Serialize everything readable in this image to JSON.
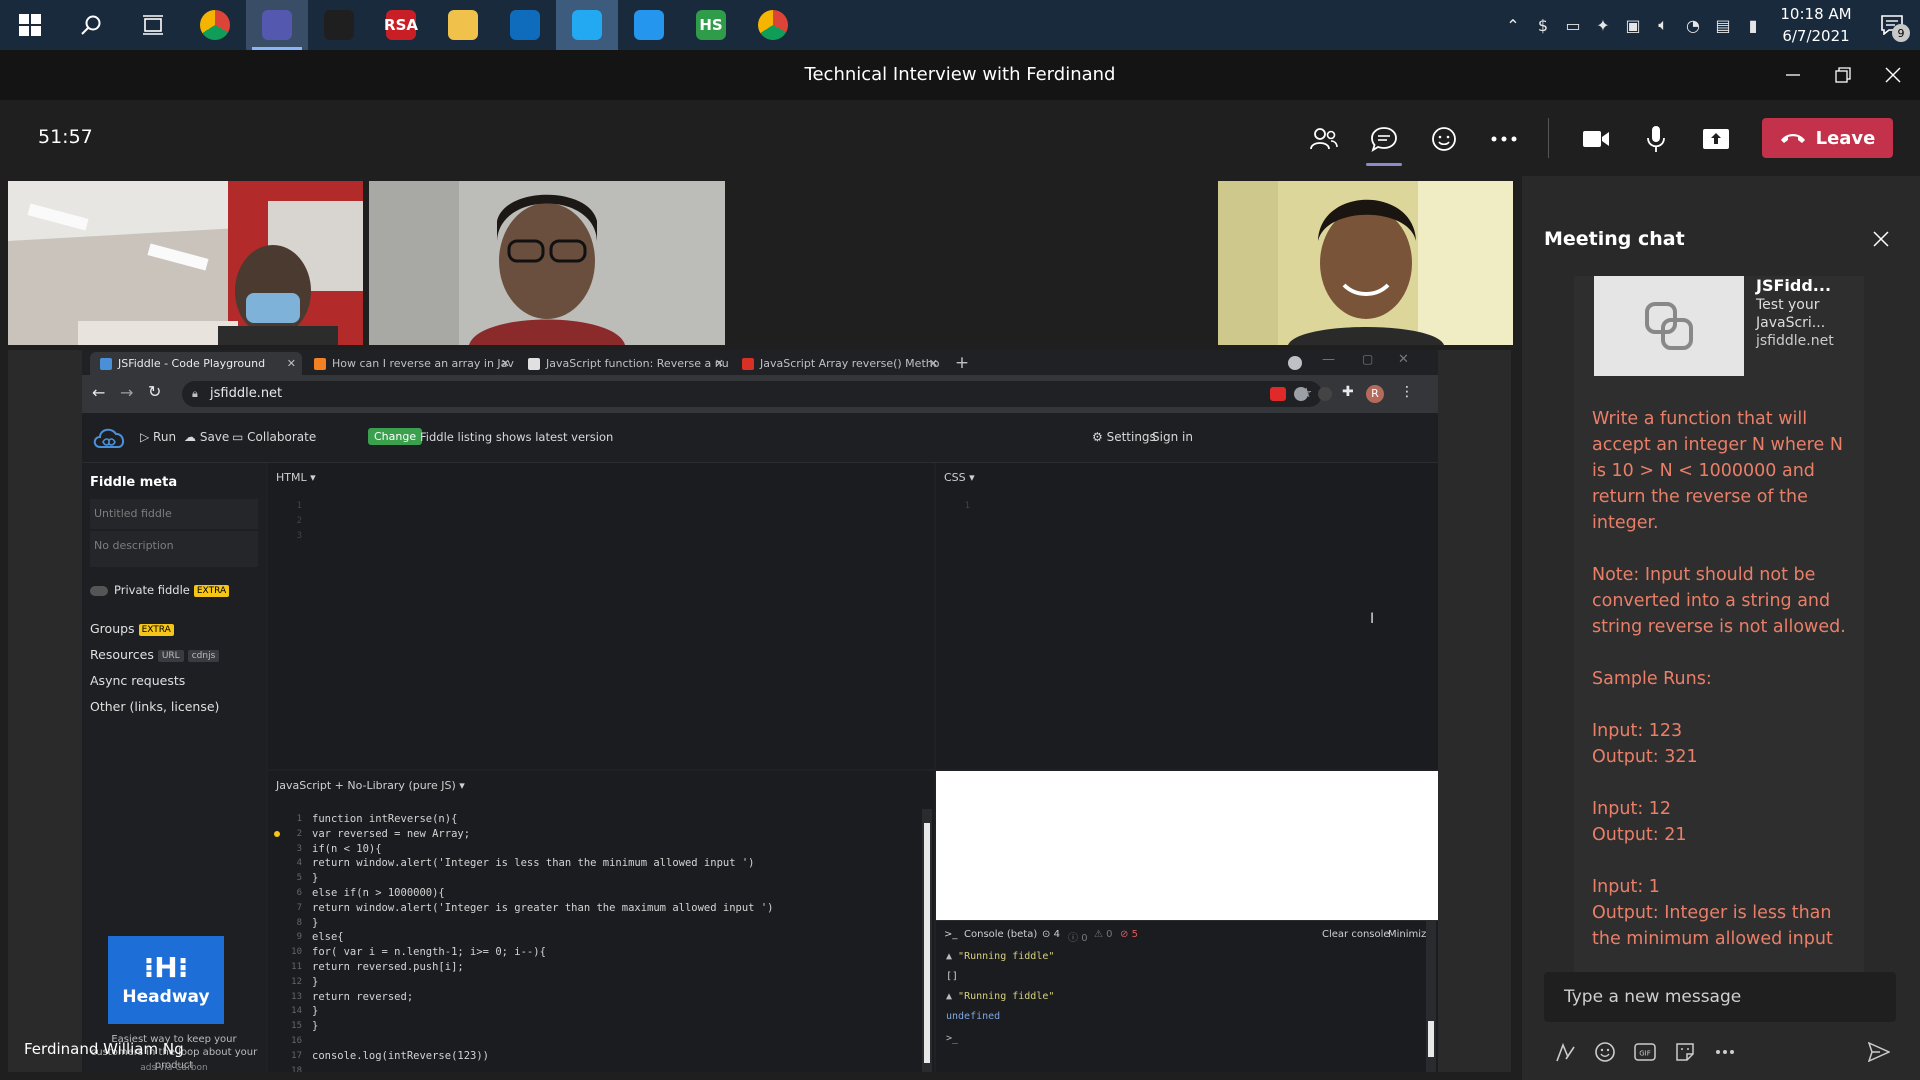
{
  "taskbar": {
    "apps": [
      {
        "icon": "chrome-icon",
        "color": "#e8453c"
      },
      {
        "icon": "teams-icon",
        "color": "#5558af"
      },
      {
        "icon": "s-app-icon",
        "color": "#1f1f1f"
      },
      {
        "icon": "rsa-icon",
        "color": "#c71f25",
        "text": "RSA"
      },
      {
        "icon": "file-explorer-icon",
        "color": "#f0c24b"
      },
      {
        "icon": "outlook-icon",
        "color": "#0f6cbd"
      },
      {
        "icon": "vscode-icon",
        "color": "#23a9f2"
      },
      {
        "icon": "docker-icon",
        "color": "#2496ed"
      },
      {
        "icon": "hs-icon",
        "color": "#2e9c49",
        "text": "HS"
      },
      {
        "icon": "chrome-icon",
        "color": "#e8453c"
      }
    ],
    "time": "10:18 AM",
    "date": "6/7/2021",
    "notification_count": "9"
  },
  "window": {
    "title": "Technical Interview with Ferdinand"
  },
  "meeting": {
    "timer": "51:57",
    "leave_label": "Leave",
    "leave_color": "#c4314b",
    "participant_name": "Ferdinand William Ng"
  },
  "browser": {
    "tabs": [
      {
        "title": "JSFiddle - Code Playground"
      },
      {
        "title": "How can I reverse an array in Jav"
      },
      {
        "title": "JavaScript function: Reverse a nu"
      },
      {
        "title": "JavaScript Array reverse() Metho"
      }
    ],
    "url": "jsfiddle.net",
    "profile_initial": "R"
  },
  "jsfiddle": {
    "run": "Run",
    "save": "Save",
    "collaborate": "Collaborate",
    "change_badge": "Change",
    "listing_note": "Fiddle listing shows latest version",
    "settings": "Settings",
    "sign_in": "Sign in",
    "fiddle_meta": "Fiddle meta",
    "title_placeholder": "Untitled fiddle",
    "desc_placeholder": "No description",
    "private_fiddle": "Private fiddle",
    "extra": "EXTRA",
    "groups": "Groups",
    "resources": "Resources",
    "url_tag": "URL",
    "cdnjs_tag": "cdnjs",
    "async_requests": "Async requests",
    "other": "Other (links, license)",
    "html_label": "HTML ▾",
    "css_label": "CSS ▾",
    "js_label": "JavaScript + No-Library (pure JS) ▾",
    "code": "function intReverse(n){\nvar reversed = new Array;\nif(n < 10){\nreturn window.alert('Integer is less than the minimum allowed input ')\n}\nelse if(n > 1000000){\nreturn window.alert('Integer is greater than the maximum allowed input ')\n}\nelse{\nfor( var i = n.length-1; i>= 0; i--){\nreturn reversed.push[i];\n}\nreturn reversed;\n}\n}\n\nconsole.log(intReverse(123))",
    "code_line_numbers": "1\n2\n3\n4\n5\n6\n7\n8\n9\n10\n11\n12\n13\n14\n15\n16\n17\n18",
    "console_title": "Console (beta)",
    "console_counts": {
      "log": "4",
      "info": "0",
      "warn": "0",
      "error": "5"
    },
    "clear_console": "Clear console",
    "minimize": "Minimize",
    "console_lines": [
      "\"Running fiddle\"",
      "[]",
      "\"Running fiddle\"",
      "undefined"
    ],
    "ad_brand": "Headway",
    "ad_text": "Easiest way to keep your customers in the loop about your product",
    "ad_via": "ads via Carbon"
  },
  "chat": {
    "title": "Meeting chat",
    "preview": {
      "title": "JSFidd...",
      "description": "Test your JavaScri...",
      "url": "jsfiddle.net"
    },
    "message_paragraphs": [
      "Write a function that will accept an integer N where N is 10 > N < 1000000 and return the reverse of the integer.",
      "Note: Input should not be converted into a string and string reverse is not allowed.",
      "Sample Runs:",
      "Input: 123\nOutput: 321",
      "Input: 12\nOutput: 21",
      "Input: 1\nOutput: Integer is less than the minimum allowed input"
    ],
    "message_color": "#ea7f68",
    "compose_placeholder": "Type a new message"
  }
}
